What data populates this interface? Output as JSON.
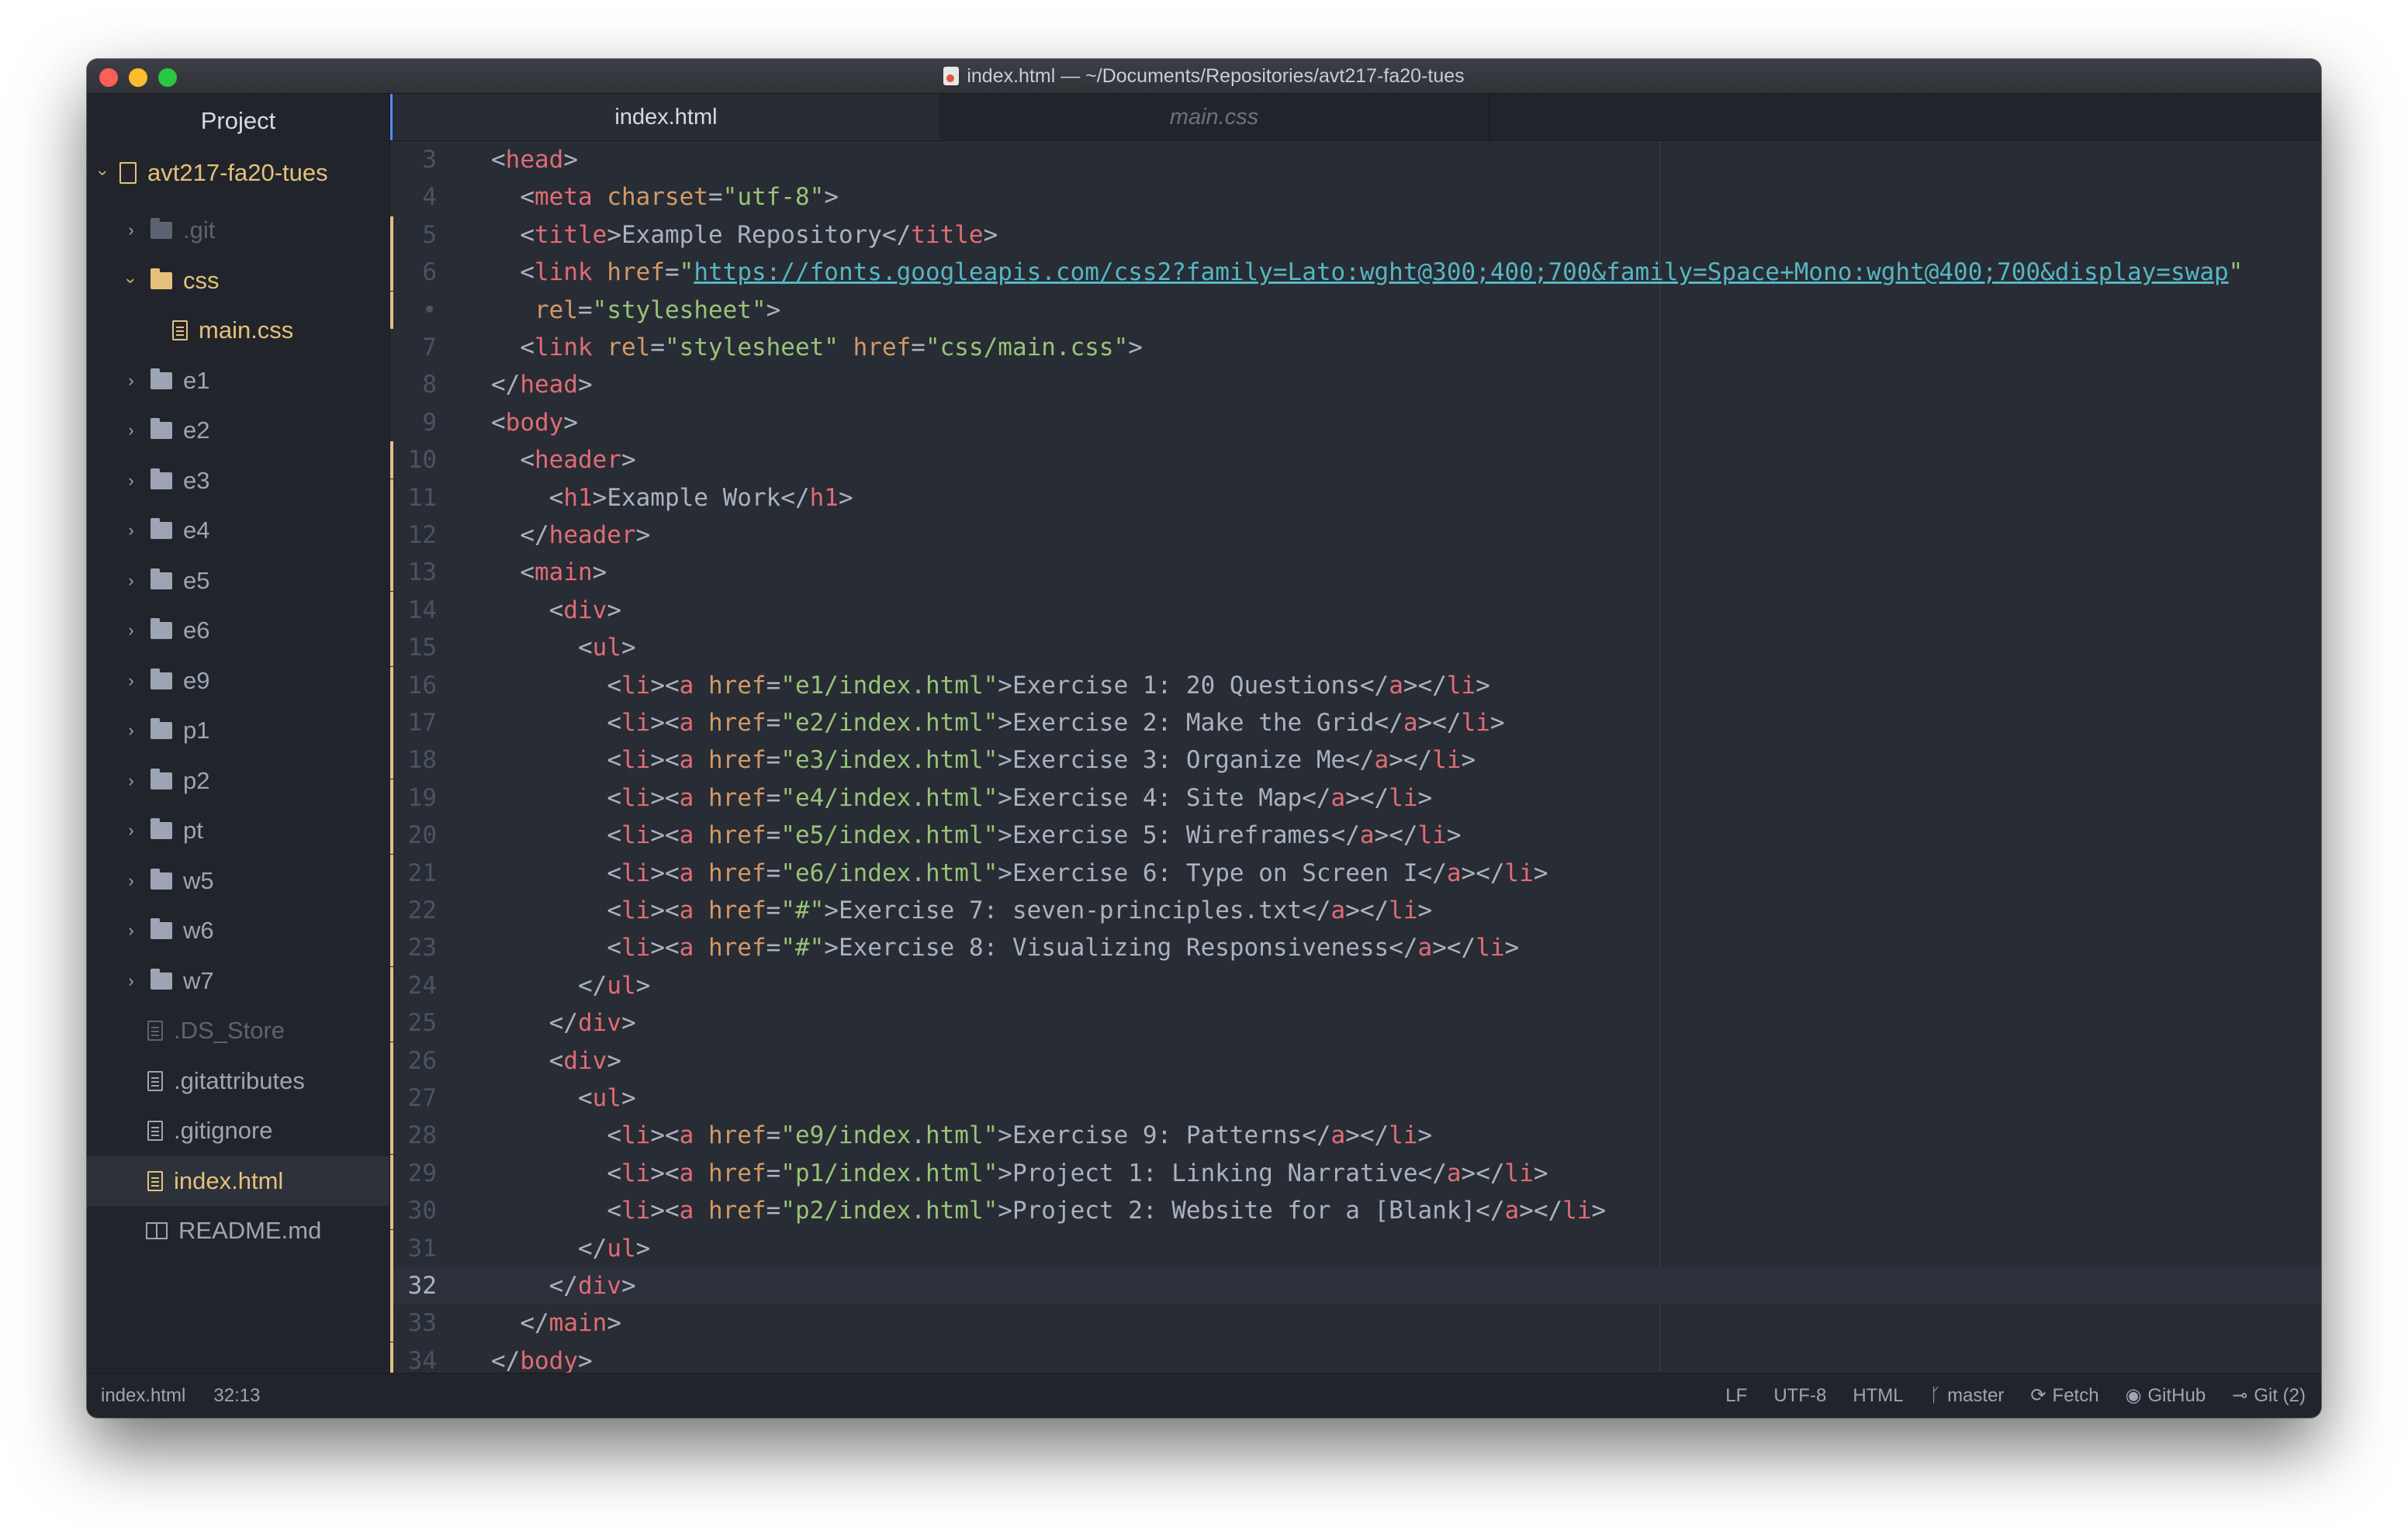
{
  "window": {
    "title": "index.html — ~/Documents/Repositories/avt217-fa20-tues"
  },
  "sidebar": {
    "header": "Project",
    "root": "avt217-fa20-tues",
    "items": [
      {
        "label": ".git",
        "type": "folder",
        "dim": true
      },
      {
        "label": "css",
        "type": "folder",
        "expanded": true,
        "color": "yellow"
      },
      {
        "label": "main.css",
        "type": "file",
        "color": "yellow"
      },
      {
        "label": "e1",
        "type": "folder"
      },
      {
        "label": "e2",
        "type": "folder"
      },
      {
        "label": "e3",
        "type": "folder"
      },
      {
        "label": "e4",
        "type": "folder"
      },
      {
        "label": "e5",
        "type": "folder"
      },
      {
        "label": "e6",
        "type": "folder"
      },
      {
        "label": "e9",
        "type": "folder"
      },
      {
        "label": "p1",
        "type": "folder"
      },
      {
        "label": "p2",
        "type": "folder"
      },
      {
        "label": "pt",
        "type": "folder"
      },
      {
        "label": "w5",
        "type": "folder"
      },
      {
        "label": "w6",
        "type": "folder"
      },
      {
        "label": "w7",
        "type": "folder"
      },
      {
        "label": ".DS_Store",
        "type": "file",
        "dim": true
      },
      {
        "label": ".gitattributes",
        "type": "file"
      },
      {
        "label": ".gitignore",
        "type": "file"
      },
      {
        "label": "index.html",
        "type": "file",
        "selected": true
      },
      {
        "label": "README.md",
        "type": "book"
      }
    ]
  },
  "tabs": [
    {
      "label": "index.html",
      "active": true
    },
    {
      "label": "main.css",
      "active": false
    }
  ],
  "editor": {
    "lines": [
      {
        "n": "3",
        "html": "<span class=\"p\">&lt;</span><span class=\"t\">head</span><span class=\"p\">&gt;</span>"
      },
      {
        "n": "4",
        "html": "  <span class=\"p\">&lt;</span><span class=\"t\">meta</span> <span class=\"a\">charset</span><span class=\"p\">=</span><span class=\"s\">\"utf-8\"</span><span class=\"p\">&gt;</span>"
      },
      {
        "n": "5",
        "html": "  <span class=\"p\">&lt;</span><span class=\"t\">title</span><span class=\"p\">&gt;Example Repository&lt;/</span><span class=\"t\">title</span><span class=\"p\">&gt;</span>",
        "mod": true
      },
      {
        "n": "6",
        "html": "  <span class=\"p\">&lt;</span><span class=\"t\">link</span> <span class=\"a\">href</span><span class=\"p\">=</span><span class=\"s\">\"</span><span class=\"u\">https://fonts.googleapis.com/css2?family=Lato:wght@300;400;700&amp;family=Space+Mono:wght@400;700&amp;display=swap</span><span class=\"s\">\"</span>",
        "mod": true
      },
      {
        "n": "•",
        "html": "   <span class=\"a\">rel</span><span class=\"p\">=</span><span class=\"s\">\"stylesheet\"</span><span class=\"p\">&gt;</span>",
        "mod": true
      },
      {
        "n": "7",
        "html": "  <span class=\"p\">&lt;</span><span class=\"t\">link</span> <span class=\"a\">rel</span><span class=\"p\">=</span><span class=\"s\">\"stylesheet\"</span> <span class=\"a\">href</span><span class=\"p\">=</span><span class=\"s\">\"css/main.css\"</span><span class=\"p\">&gt;</span>"
      },
      {
        "n": "8",
        "html": "<span class=\"p\">&lt;/</span><span class=\"t\">head</span><span class=\"p\">&gt;</span>"
      },
      {
        "n": "9",
        "html": "<span class=\"p\">&lt;</span><span class=\"t\">body</span><span class=\"p\">&gt;</span>"
      },
      {
        "n": "10",
        "html": "  <span class=\"p\">&lt;</span><span class=\"t\">header</span><span class=\"p\">&gt;</span>",
        "mod": true
      },
      {
        "n": "11",
        "html": "    <span class=\"p\">&lt;</span><span class=\"t\">h1</span><span class=\"p\">&gt;Example Work&lt;/</span><span class=\"t\">h1</span><span class=\"p\">&gt;</span>",
        "mod": true
      },
      {
        "n": "12",
        "html": "  <span class=\"p\">&lt;/</span><span class=\"t\">header</span><span class=\"p\">&gt;</span>",
        "mod": true
      },
      {
        "n": "13",
        "html": "  <span class=\"p\">&lt;</span><span class=\"t\">main</span><span class=\"p\">&gt;</span>",
        "mod": true
      },
      {
        "n": "14",
        "html": "    <span class=\"p\">&lt;</span><span class=\"t\">div</span><span class=\"p\">&gt;</span>",
        "mod": true
      },
      {
        "n": "15",
        "html": "      <span class=\"p\">&lt;</span><span class=\"t\">ul</span><span class=\"p\">&gt;</span>",
        "mod": true
      },
      {
        "n": "16",
        "html": "        <span class=\"p\">&lt;</span><span class=\"t\">li</span><span class=\"p\">&gt;&lt;</span><span class=\"t\">a</span> <span class=\"a\">href</span><span class=\"p\">=</span><span class=\"s\">\"e1/index.html\"</span><span class=\"p\">&gt;Exercise 1: 20 Questions&lt;/</span><span class=\"t\">a</span><span class=\"p\">&gt;&lt;/</span><span class=\"t\">li</span><span class=\"p\">&gt;</span>",
        "mod": true
      },
      {
        "n": "17",
        "html": "        <span class=\"p\">&lt;</span><span class=\"t\">li</span><span class=\"p\">&gt;&lt;</span><span class=\"t\">a</span> <span class=\"a\">href</span><span class=\"p\">=</span><span class=\"s\">\"e2/index.html\"</span><span class=\"p\">&gt;Exercise 2: Make the Grid&lt;/</span><span class=\"t\">a</span><span class=\"p\">&gt;&lt;/</span><span class=\"t\">li</span><span class=\"p\">&gt;</span>",
        "mod": true
      },
      {
        "n": "18",
        "html": "        <span class=\"p\">&lt;</span><span class=\"t\">li</span><span class=\"p\">&gt;&lt;</span><span class=\"t\">a</span> <span class=\"a\">href</span><span class=\"p\">=</span><span class=\"s\">\"e3/index.html\"</span><span class=\"p\">&gt;Exercise 3: Organize Me&lt;/</span><span class=\"t\">a</span><span class=\"p\">&gt;&lt;/</span><span class=\"t\">li</span><span class=\"p\">&gt;</span>",
        "mod": true
      },
      {
        "n": "19",
        "html": "        <span class=\"p\">&lt;</span><span class=\"t\">li</span><span class=\"p\">&gt;&lt;</span><span class=\"t\">a</span> <span class=\"a\">href</span><span class=\"p\">=</span><span class=\"s\">\"e4/index.html\"</span><span class=\"p\">&gt;Exercise 4: Site Map&lt;/</span><span class=\"t\">a</span><span class=\"p\">&gt;&lt;/</span><span class=\"t\">li</span><span class=\"p\">&gt;</span>",
        "mod": true
      },
      {
        "n": "20",
        "html": "        <span class=\"p\">&lt;</span><span class=\"t\">li</span><span class=\"p\">&gt;&lt;</span><span class=\"t\">a</span> <span class=\"a\">href</span><span class=\"p\">=</span><span class=\"s\">\"e5/index.html\"</span><span class=\"p\">&gt;Exercise 5: Wireframes&lt;/</span><span class=\"t\">a</span><span class=\"p\">&gt;&lt;/</span><span class=\"t\">li</span><span class=\"p\">&gt;</span>",
        "mod": true
      },
      {
        "n": "21",
        "html": "        <span class=\"p\">&lt;</span><span class=\"t\">li</span><span class=\"p\">&gt;&lt;</span><span class=\"t\">a</span> <span class=\"a\">href</span><span class=\"p\">=</span><span class=\"s\">\"e6/index.html\"</span><span class=\"p\">&gt;Exercise 6: Type on Screen I&lt;/</span><span class=\"t\">a</span><span class=\"p\">&gt;&lt;/</span><span class=\"t\">li</span><span class=\"p\">&gt;</span>",
        "mod": true
      },
      {
        "n": "22",
        "html": "        <span class=\"p\">&lt;</span><span class=\"t\">li</span><span class=\"p\">&gt;&lt;</span><span class=\"t\">a</span> <span class=\"a\">href</span><span class=\"p\">=</span><span class=\"s\">\"#\"</span><span class=\"p\">&gt;Exercise 7: seven-principles.txt&lt;/</span><span class=\"t\">a</span><span class=\"p\">&gt;&lt;/</span><span class=\"t\">li</span><span class=\"p\">&gt;</span>",
        "mod": true
      },
      {
        "n": "23",
        "html": "        <span class=\"p\">&lt;</span><span class=\"t\">li</span><span class=\"p\">&gt;&lt;</span><span class=\"t\">a</span> <span class=\"a\">href</span><span class=\"p\">=</span><span class=\"s\">\"#\"</span><span class=\"p\">&gt;Exercise 8: Visualizing Responsiveness&lt;/</span><span class=\"t\">a</span><span class=\"p\">&gt;&lt;/</span><span class=\"t\">li</span><span class=\"p\">&gt;</span>",
        "mod": true
      },
      {
        "n": "24",
        "html": "      <span class=\"p\">&lt;/</span><span class=\"t\">ul</span><span class=\"p\">&gt;</span>",
        "mod": true
      },
      {
        "n": "25",
        "html": "    <span class=\"p\">&lt;/</span><span class=\"t\">div</span><span class=\"p\">&gt;</span>",
        "mod": true
      },
      {
        "n": "26",
        "html": "    <span class=\"p\">&lt;</span><span class=\"t\">div</span><span class=\"p\">&gt;</span>",
        "mod": true
      },
      {
        "n": "27",
        "html": "      <span class=\"p\">&lt;</span><span class=\"t\">ul</span><span class=\"p\">&gt;</span>",
        "mod": true
      },
      {
        "n": "28",
        "html": "        <span class=\"p\">&lt;</span><span class=\"t\">li</span><span class=\"p\">&gt;&lt;</span><span class=\"t\">a</span> <span class=\"a\">href</span><span class=\"p\">=</span><span class=\"s\">\"e9/index.html\"</span><span class=\"p\">&gt;Exercise 9: Patterns&lt;/</span><span class=\"t\">a</span><span class=\"p\">&gt;&lt;/</span><span class=\"t\">li</span><span class=\"p\">&gt;</span>",
        "mod": true
      },
      {
        "n": "29",
        "html": "        <span class=\"p\">&lt;</span><span class=\"t\">li</span><span class=\"p\">&gt;&lt;</span><span class=\"t\">a</span> <span class=\"a\">href</span><span class=\"p\">=</span><span class=\"s\">\"p1/index.html\"</span><span class=\"p\">&gt;Project 1: Linking Narrative&lt;/</span><span class=\"t\">a</span><span class=\"p\">&gt;&lt;/</span><span class=\"t\">li</span><span class=\"p\">&gt;</span>",
        "mod": true
      },
      {
        "n": "30",
        "html": "        <span class=\"p\">&lt;</span><span class=\"t\">li</span><span class=\"p\">&gt;&lt;</span><span class=\"t\">a</span> <span class=\"a\">href</span><span class=\"p\">=</span><span class=\"s\">\"p2/index.html\"</span><span class=\"p\">&gt;Project 2: Website for a [Blank]&lt;/</span><span class=\"t\">a</span><span class=\"p\">&gt;&lt;/</span><span class=\"t\">li</span><span class=\"p\">&gt;</span>",
        "mod": true
      },
      {
        "n": "31",
        "html": "      <span class=\"p\">&lt;/</span><span class=\"t\">ul</span><span class=\"p\">&gt;</span>",
        "mod": true
      },
      {
        "n": "32",
        "html": "    <span class=\"p\">&lt;/</span><span class=\"t\">div</span><span class=\"p\">&gt;</span>",
        "mod": true,
        "cursor": true
      },
      {
        "n": "33",
        "html": "  <span class=\"p\">&lt;/</span><span class=\"t\">main</span><span class=\"p\">&gt;</span>",
        "mod": true
      },
      {
        "n": "34",
        "html": "<span class=\"p\">&lt;/</span><span class=\"t\">body</span><span class=\"p\">&gt;</span>",
        "mod": true
      }
    ]
  },
  "statusbar": {
    "file": "index.html",
    "cursor": "32:13",
    "line_ending": "LF",
    "encoding": "UTF-8",
    "grammar": "HTML",
    "branch": "master",
    "fetch": "Fetch",
    "github": "GitHub",
    "git": "Git (2)"
  },
  "colors": {
    "background": "#282c34",
    "sidebar": "#21252b",
    "tag": "#e06c75",
    "attribute": "#d19a66",
    "string": "#98c379",
    "url": "#56b6c2",
    "folder_highlight": "#e5c07b",
    "accent": "#568af2"
  }
}
